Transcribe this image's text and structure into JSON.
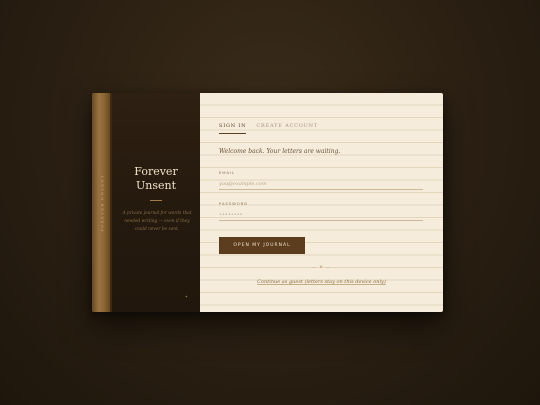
{
  "spine": {
    "title": "Forever Unsent"
  },
  "cover": {
    "title_line1": "Forever",
    "title_line2": "Unsent",
    "tagline": "A private journal for words that needed writing — even if they could never be sent.",
    "mark": "✦"
  },
  "tabs": [
    {
      "label": "Sign In",
      "active": true
    },
    {
      "label": "Create Account",
      "active": false
    }
  ],
  "welcome": "Welcome back. Your letters are waiting.",
  "form": {
    "email_label": "Email",
    "email_placeholder": "you@example.com",
    "email_value": "",
    "password_label": "Password",
    "password_placeholder": "••••••••",
    "password_value": "",
    "submit_label": "Open My Journal"
  },
  "ornament": "— ❦ —",
  "guest_link": "Continue as guest (letters stay on this device only)",
  "colors": {
    "background": "#2a1f12",
    "cover": "#251a0e",
    "page": "#f5ecdb",
    "accent": "#5c3d1e",
    "spine": "#9a7440"
  }
}
